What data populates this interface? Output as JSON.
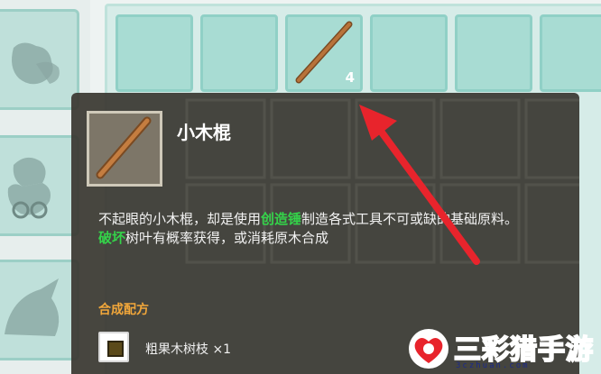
{
  "inventory": {
    "slots_visible": 6,
    "stick_count": "4"
  },
  "tooltip": {
    "item_name": "小木棍",
    "description": {
      "part1": "不起眼的小木棍，却是使用",
      "highlight1": "创造锤",
      "part2": "制造各式工具不可或缺的基础原料。",
      "highlight2": "破坏",
      "part3": "树叶有概率获得，或消耗原木合成"
    },
    "recipe_title": "合成配方",
    "ingredient": "粗果木树枝 ×1"
  },
  "watermark": {
    "text": "三彩猎手游",
    "site": "3czhuan.com"
  },
  "colors": {
    "highlight": "#34d34a",
    "recipe_title": "#f2a73a",
    "arrow": "#e8242c",
    "panel": "#3a3831"
  }
}
